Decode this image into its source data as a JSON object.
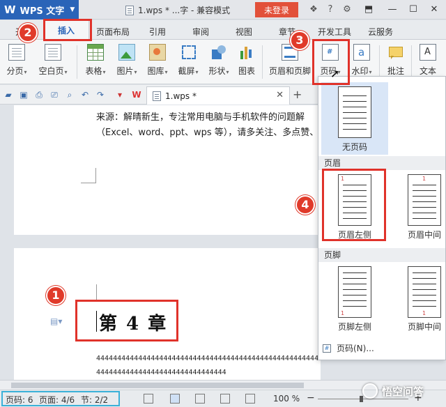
{
  "titlebar": {
    "app_name": "WPS 文字",
    "doc_title": "1.wps * ...字 - 兼容模式",
    "login_label": "未登录"
  },
  "tabs": [
    "插入",
    "页面布局",
    "引用",
    "审阅",
    "视图",
    "章节",
    "开发工具",
    "云服务"
  ],
  "ribbon": {
    "items": [
      {
        "label": "分页",
        "icon": "page-break-icon"
      },
      {
        "label": "空白页",
        "icon": "blank-page-icon"
      },
      {
        "label": "表格",
        "icon": "table-icon"
      },
      {
        "label": "图片",
        "icon": "picture-icon"
      },
      {
        "label": "图库",
        "icon": "gallery-icon"
      },
      {
        "label": "截屏",
        "icon": "screenshot-icon"
      },
      {
        "label": "形状",
        "icon": "shapes-icon"
      },
      {
        "label": "图表",
        "icon": "chart-icon"
      },
      {
        "label": "页眉和页脚",
        "icon": "header-footer-icon"
      },
      {
        "label": "页码",
        "icon": "page-number-icon"
      },
      {
        "label": "水印",
        "icon": "watermark-icon"
      },
      {
        "label": "批注",
        "icon": "comment-icon"
      },
      {
        "label": "文本",
        "icon": "text-box-icon"
      }
    ]
  },
  "doc_tab": {
    "label": "1.wps *"
  },
  "document": {
    "line1": "来源：解晴新生，专注常用电脑与手机软件的问题解",
    "line2": "（Excel、word、ppt、wps 等），请多关注、多点赞、",
    "chapter": "第 4 章",
    "numbers_line1": "444444444444444444444444444444444444444444444444444444444",
    "numbers_line2": "4444444444444444444444444444444"
  },
  "dropdown": {
    "no_page_number": "无页码",
    "header_section": "页眉",
    "header_left": "页眉左侧",
    "header_center": "页眉中间",
    "footer_section": "页脚",
    "footer_left": "页脚左侧",
    "footer_center": "页脚中间",
    "page_number_item": "页码(N)...",
    "thumb_num": "1"
  },
  "markers": [
    "1",
    "2",
    "3",
    "4"
  ],
  "status": {
    "page_num": "页码: 6",
    "pages": "页面: 4/6",
    "section": "节: 2/2",
    "zoom": "100 %"
  },
  "watermark_text": "悟空问答",
  "colors": {
    "accent": "#2a64b8",
    "login": "#e2513a",
    "marker": "#e03a2a"
  }
}
